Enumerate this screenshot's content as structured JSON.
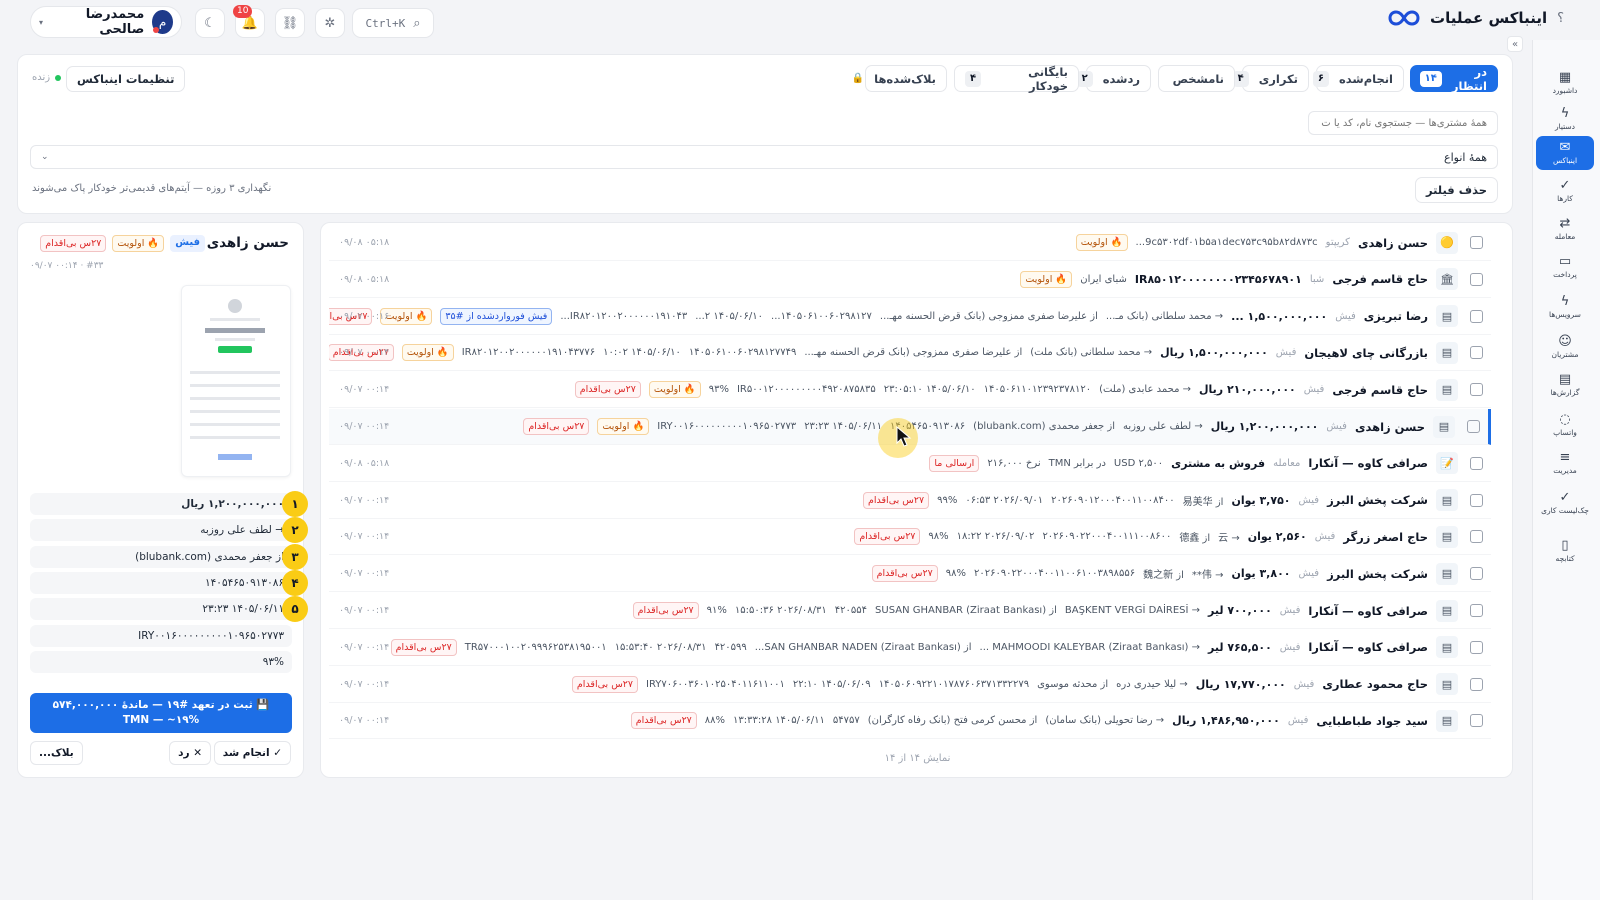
{
  "app": {
    "title": "اینباکس عملیات",
    "help": "؟",
    "search_shortcut": "Ctrl+K",
    "notif_count": "10",
    "user": {
      "initial": "م",
      "name": "محمدرضا صالحی"
    }
  },
  "sidebar": {
    "items": [
      {
        "label": "داشبورد",
        "icon": "dashboard-icon",
        "glyph": "▦"
      },
      {
        "label": "دستیار",
        "icon": "bolt-icon",
        "glyph": "ϟ"
      },
      {
        "label": "اینباکس",
        "icon": "inbox-icon",
        "glyph": "✉",
        "active": true
      },
      {
        "label": "کارها",
        "icon": "check-icon",
        "glyph": "✓"
      },
      {
        "label": "معامله",
        "icon": "exchange-icon",
        "glyph": "⇄"
      },
      {
        "label": "پرداخت",
        "icon": "card-icon",
        "glyph": "▭"
      },
      {
        "label": "سرویس‌ها",
        "icon": "bolt-icon",
        "glyph": "ϟ"
      },
      {
        "label": "مشتریان",
        "icon": "users-icon",
        "glyph": "☺"
      },
      {
        "label": "گزارش‌ها",
        "icon": "report-icon",
        "glyph": "▤"
      },
      {
        "label": "واتساپ",
        "icon": "chat-icon",
        "glyph": "◌"
      },
      {
        "label": "مدیریت",
        "icon": "sliders-icon",
        "glyph": "≡"
      },
      {
        "label": "چک‌لیست کاری",
        "icon": "checklist-icon",
        "glyph": "✓"
      },
      {
        "label": "کتابچه",
        "icon": "book-icon",
        "glyph": "▯"
      }
    ]
  },
  "filters": {
    "tabs": [
      {
        "label": "در انتظار",
        "count": "۱۴",
        "active": true
      },
      {
        "label": "انجام‌شده",
        "count": "۶"
      },
      {
        "label": "تکراری",
        "count": "۴"
      },
      {
        "label": "نامشخص",
        "count": ""
      },
      {
        "label": "ردشده",
        "count": "۲"
      },
      {
        "label": "بایگانی خودکار",
        "count": "۴"
      },
      {
        "label": "بلاک‌شده‌ها",
        "count": "",
        "icon": "lock-icon"
      }
    ],
    "settings_label": "تنظیمات اینباکس",
    "live_label": "زنده",
    "search_placeholder": "همهٔ مشتری‌ها — جستجوی نام، کد یا ت",
    "type_select": "همهٔ انواع",
    "clear_label": "حذف فیلتر",
    "retention_note": "نگهداری ۳ روزه — آیتم‌های قدیمی‌تر خودکار پاک می‌شوند"
  },
  "list": {
    "rows": [
      {
        "thumb": "🟡",
        "name": "حسن زاهدی",
        "kind": "کریپتو",
        "amount": "",
        "parts": [
          "9c۵۳۰۲df۰۱b۵a۱dec۷۵۳c۹۵b۸۲d۸۷۳c..."
        ],
        "chips": [
          {
            "t": "🔥 اولویت",
            "c": "pr"
          }
        ],
        "time": "۰۹/۰۸ ۰۵:۱۸"
      },
      {
        "thumb": "🏛",
        "name": "حاج قاسم فرجی",
        "kind": "شبا",
        "amount": "IR۸۵۰۱۲۰۰۰۰۰۰۰۰۲۳۴۵۶۷۸۹۰۱",
        "parts": [
          "شبای ایران"
        ],
        "chips": [
          {
            "t": "🔥 اولویت",
            "c": "pr"
          }
        ],
        "time": "۰۹/۰۸ ۰۵:۱۸"
      },
      {
        "thumb": "▤",
        "name": "رضا تبریزی",
        "kind": "فیش",
        "amount": "۱,۵۰۰,۰۰۰,۰۰۰ ...",
        "parts": [
          "→ محمد سلطانی (بانک مـ...",
          "از علیرضا صفری ممزوجی (بانک قرض الحسنه مهـ...",
          "۱۴۰۵۰۶۱۰۰۶۰۲۹۸۱۲۷...",
          "۱۴۰۵/۰۶/۱۰ ۲...",
          "IR۸۲۰۱۲۰۰۲۰۰۰۰۰۰۱۹۱۰۴۳..."
        ],
        "chips": [
          {
            "t": "فیش فورواردشده از #۳۵",
            "c": "blue"
          },
          {
            "t": "🔥 اولویت",
            "c": "pr"
          },
          {
            "t": "۲۷س بی‌اقدام",
            "c": "red2"
          }
        ],
        "time": "۰۹/۰۷ ۰۰:۱۶"
      },
      {
        "thumb": "▤",
        "name": "بازرگانی چای لاهیجان",
        "kind": "فیش",
        "amount": "۱,۵۰۰,۰۰۰,۰۰۰ ریال",
        "parts": [
          "→ محمد سلطانی (بانک ملت)",
          "از علیرضا صفری ممزوجی (بانک قرض الحسنه مهـ...",
          "۱۴۰۵۰۶۱۰۰۶۰۲۹۸۱۲۷۷۴۹",
          "۱۴۰۵/۰۶/۱۰ ۱۰:۰۲",
          "IR۸۲۰۱۲۰۰۲۰۰۰۰۰۰۱۹۱۰۴۳۷۷۶"
        ],
        "chips": [
          {
            "t": "🔥 اولویت",
            "c": "pr"
          },
          {
            "t": "۲۷س بی‌اقدام",
            "c": "red2"
          }
        ],
        "time": "۰۹/۰۷ ۰۰:۱۴"
      },
      {
        "thumb": "▤",
        "name": "حاج قاسم فرجی",
        "kind": "فیش",
        "amount": "۲۱۰,۰۰۰,۰۰۰ ریال",
        "parts": [
          "→ محمد عابدی (ملت)",
          "۱۴۰۵۰۶۱۱۰۱۲۳۹۲۳۷۸۱۲۰",
          "۱۴۰۵/۰۶/۱۰ ۲۳:۰۵:۱۰",
          "IR۵۰۰۱۲۰۰۰۰۰۰۰۰۰۴۹۲۰۸۷۵۸۳۵",
          "۹۳%"
        ],
        "chips": [
          {
            "t": "🔥 اولویت",
            "c": "pr"
          },
          {
            "t": "۲۷س بی‌اقدام",
            "c": "red2"
          }
        ],
        "time": "۰۹/۰۷ ۰۰:۱۴"
      },
      {
        "thumb": "▤",
        "name": "حسن زاهدی",
        "kind": "فیش",
        "amount": "۱,۲۰۰,۰۰۰,۰۰۰ ریال",
        "parts": [
          "→ لطف علی روزبه",
          "از جعفر محمدی (blubank.com)",
          "۱۴۰۵۴۶۵۰۹۱۳۰۸۶",
          "۱۴۰۵/۰۶/۱۱ ۲۳:۲۳",
          "IRY۰۰۱۶۰۰۰۰۰۰۰۰۰۱۰۹۶۵۰۲۷۷۳"
        ],
        "chips": [
          {
            "t": "🔥 اولویت",
            "c": "pr"
          },
          {
            "t": "۲۷س بی‌اقدام",
            "c": "red2"
          }
        ],
        "time": "۰۹/۰۷ ۰۰:۱۴",
        "sel": true
      },
      {
        "thumb": "📝",
        "name": "صرافی کاوه — آنکارا",
        "kind": "معامله",
        "amount": "فروش به مشتری",
        "parts": [
          "USD ۲,۵۰۰",
          "در برابر TMN",
          "نرخ ۲۱۶,۰۰۰"
        ],
        "chips": [
          {
            "t": "ارسالی ما",
            "c": "red2"
          }
        ],
        "time": "۰۹/۰۸ ۰۵:۱۸"
      },
      {
        "thumb": "▤",
        "name": "شرکت پخش البرز",
        "kind": "فیش",
        "amount": "۳,۷۵۰ یوان",
        "parts": [
          "از 易美华",
          "۲۰۲۶۰۹۰۱۲۰۰۰۴۰۰۱۱۰۰۸۴۰۰",
          "۲۰۲۶/۰۹/۰۱ ۰۶:۵۳",
          "۹۹%"
        ],
        "chips": [
          {
            "t": "۲۷س بی‌اقدام",
            "c": "red2"
          }
        ],
        "time": "۰۹/۰۷ ۰۰:۱۴"
      },
      {
        "thumb": "▤",
        "name": "حاج اصغر زرگر",
        "kind": "فیش",
        "amount": "۲,۵۶۰ یوان",
        "parts": [
          "→ 云",
          "از 德鑫",
          "۲۰۲۶۰۹۰۲۲۰۰۰۴۰۰۱۱۱۰۰۸۶۰۰",
          "۲۰۲۶/۰۹/۰۲ ۱۸:۲۲",
          "۹۸%"
        ],
        "chips": [
          {
            "t": "۲۷س بی‌اقدام",
            "c": "red2"
          }
        ],
        "time": "۰۹/۰۷ ۰۰:۱۴"
      },
      {
        "thumb": "▤",
        "name": "شرکت پخش البرز",
        "kind": "فیش",
        "amount": "۳,۸۰۰ یوان",
        "parts": [
          "→ 伟**",
          "از 魏之新",
          "۲۰۲۶۰۹۰۲۲۰۰۰۴۰۰۱۱۰۰۶۱۰۰۳۸۹۸۵۵۶",
          "۹۸%"
        ],
        "chips": [
          {
            "t": "۲۷س بی‌اقدام",
            "c": "red2"
          }
        ],
        "time": "۰۹/۰۷ ۰۰:۱۴"
      },
      {
        "thumb": "▤",
        "name": "صرافی کاوه — آنکارا",
        "kind": "فیش",
        "amount": "۷۰۰,۰۰۰ لیر",
        "parts": [
          "→ BAŞKENT VERGİ DAİRESİ",
          "از SUSAN GHANBAR (Ziraat Bankası)",
          "۴۲۰۵۵۴",
          "۲۰۲۶/۰۸/۳۱ ۱۵:۵۰:۳۶",
          "۹۱%"
        ],
        "chips": [
          {
            "t": "۲۷س بی‌اقدام",
            "c": "red2"
          }
        ],
        "time": "۰۹/۰۷ ۰۰:۱۴"
      },
      {
        "thumb": "▤",
        "name": "صرافی کاوه — آنکارا",
        "kind": "فیش",
        "amount": "۷۶۵,۵۰۰ لیر",
        "parts": [
          "→ MAHMOODI KALEYBAR (Ziraat Bankası) ...",
          "از SAN GHANBAR NADEN (Ziraat Bankası)...",
          "۴۲۰۵۹۹",
          "۲۰۲۶/۰۸/۳۱ ۱۵:۵۳:۴۰",
          "TR۵۷۰۰۰۱۰۰۲۰۹۹۹۶۲۵۳۸۱۹۵۰۰۱"
        ],
        "chips": [
          {
            "t": "۲۷س بی‌اقدام",
            "c": "red2"
          }
        ],
        "time": "۰۹/۰۷ ۰۰:۱۴"
      },
      {
        "thumb": "▤",
        "name": "حاج محمود عطاری",
        "kind": "فیش",
        "amount": "۱۷,۷۷۰,۰۰۰ ریال",
        "parts": [
          "→ لیلا حیدری دره",
          "از محدثه موسوی",
          "۱۴۰۵۰۶۰۹۲۲۱۰۱۷۸۷۶۰۶۳۷۱۳۳۲۲۷۹",
          "۱۴۰۵/۰۶/۰۹ ۲۲:۱۰",
          "IRY۷۰۶۰۰۳۶۰۱۰۲۵۰۴۰۱۱۶۱۱۰۰۱"
        ],
        "chips": [
          {
            "t": "۲۷س بی‌اقدام",
            "c": "red2"
          }
        ],
        "time": "۰۹/۰۷ ۰۰:۱۴"
      },
      {
        "thumb": "▤",
        "name": "سید جواد طباطبایی",
        "kind": "فیش",
        "amount": "۱,۴۸۶,۹۵۰,۰۰۰ ریال",
        "parts": [
          "→ رضا تحویلی (بانک سامان)",
          "از محسن کرمی فتح (بانک رفاه کارگران)",
          "۵۴۷۵۷",
          "۱۴۰۵/۰۶/۱۱ ۱۳:۳۳:۲۸",
          "۸۸%"
        ],
        "chips": [
          {
            "t": "۲۷س بی‌اقدام",
            "c": "red2"
          }
        ],
        "time": "۰۹/۰۷ ۰۰:۱۴"
      }
    ],
    "count_label": "نمایش ۱۴ از ۱۴"
  },
  "detail": {
    "name": "حسن زاهدی",
    "kind": "فیش",
    "priority": "🔥 اولویت",
    "stale": "۲۷س بی‌اقدام",
    "meta": "۰۹/۰۷ ۰۰:۱۴ · #۳۳",
    "fields": [
      {
        "n": "۱",
        "v": "۱,۲۰۰,۰۰۰,۰۰۰ ریال",
        "bold": true
      },
      {
        "n": "۲",
        "v": "→ لطف علی روزبه"
      },
      {
        "n": "۳",
        "v": "از جعفر محمدی (blubank.com)"
      },
      {
        "n": "۴",
        "v": "۱۴۰۵۴۶۵۰۹۱۳۰۸۶"
      },
      {
        "n": "۵",
        "v": "۱۴۰۵/۰۶/۱۱ ۲۳:۲۳"
      },
      {
        "n": "",
        "v": "IRY۰۰۱۶۰۰۰۰۰۰۰۰۰۱۰۹۶۵۰۲۷۷۳"
      },
      {
        "n": "",
        "v": "۹۳%"
      }
    ],
    "commit_label": "💾 ثبت در تعهد #۱۹ — ماندهٔ ۵۷۴,۰۰۰,۰۰۰ TMN — ~۱۹%",
    "done_label": "✓ انجام شد",
    "reject_label": "✕ رد",
    "block_label": "بلاک..."
  },
  "colors": {
    "accent": "#1d6ee6",
    "danger": "#dc2626",
    "highlight": "#facc15"
  }
}
